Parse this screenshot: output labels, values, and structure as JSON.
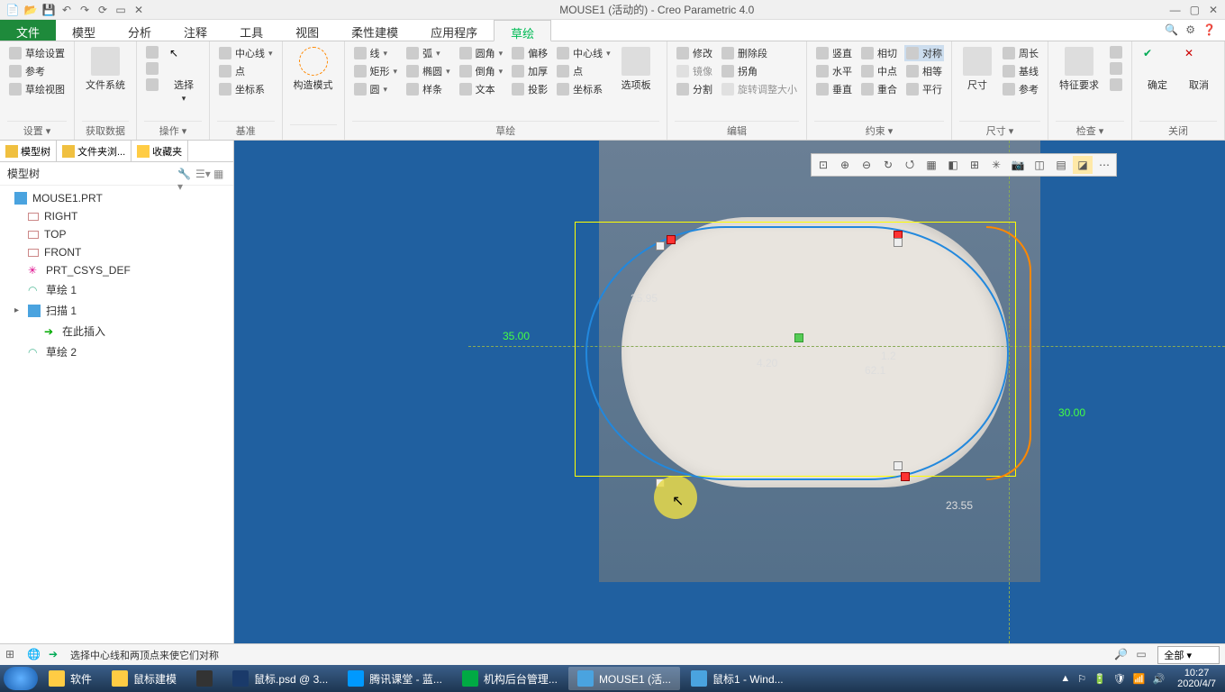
{
  "window": {
    "title": "MOUSE1 (活动的) - Creo Parametric 4.0"
  },
  "tabs": {
    "file": "文件",
    "model": "模型",
    "analyze": "分析",
    "annotate": "注释",
    "tool": "工具",
    "view": "视图",
    "flex": "柔性建模",
    "app": "应用程序",
    "sketch": "草绘"
  },
  "groups": {
    "setup": {
      "label": "设置 ▾",
      "items": [
        "草绘设置",
        "参考",
        "草绘视图"
      ]
    },
    "getdata": {
      "label": "获取数据",
      "btn": "文件系统"
    },
    "ops": {
      "label": "操作 ▾",
      "sel": "选择",
      "cut": "剪切",
      "copy": "复制",
      "paste": "粘贴"
    },
    "datum": {
      "label": "基准",
      "centerline": "中心线",
      "point": "点",
      "csys": "坐标系"
    },
    "construct": {
      "label": "",
      "btn": "构造模式"
    },
    "sketch": {
      "label": "草绘",
      "line": "线",
      "arc": "弧",
      "fillet": "圆角",
      "offset": "偏移",
      "c2": "中心线",
      "rect": "矩形",
      "ellipse": "椭圆",
      "chamfer": "倒角",
      "thick": "加厚",
      "pt": "点",
      "circle": "圆",
      "spline": "样条",
      "text": "文本",
      "project": "投影",
      "csys2": "坐标系",
      "palette": "选项板"
    },
    "edit": {
      "label": "编辑",
      "modify": "修改",
      "delseg": "删除段",
      "mirror": "镜像",
      "corner": "拐角",
      "divide": "分割",
      "rotres": "旋转调整大小"
    },
    "constrain": {
      "label": "约束 ▾",
      "vert": "竖直",
      "tangent": "相切",
      "sym": "对称",
      "horiz": "水平",
      "mid": "中点",
      "equal": "相等",
      "perp": "垂直",
      "coinc": "重合",
      "para": "平行"
    },
    "dimension": {
      "label": "尺寸 ▾",
      "dim": "尺寸",
      "perim": "周长",
      "base": "基线",
      "ref": "参考"
    },
    "inspect": {
      "label": "检查 ▾",
      "feat": "特征要求",
      "a": "▦",
      "b": "▨"
    },
    "close": {
      "label": "关闭",
      "ok": "确定",
      "cancel": "取消"
    }
  },
  "tree": {
    "tabs": [
      "模型树",
      "文件夹浏...",
      "收藏夹"
    ],
    "header": "模型树",
    "root": "MOUSE1.PRT",
    "items": [
      {
        "name": "RIGHT",
        "type": "datum"
      },
      {
        "name": "TOP",
        "type": "datum"
      },
      {
        "name": "FRONT",
        "type": "datum"
      },
      {
        "name": "PRT_CSYS_DEF",
        "type": "csys"
      },
      {
        "name": "草绘 1",
        "type": "sketch"
      },
      {
        "name": "扫描 1",
        "type": "feature",
        "exp": true
      },
      {
        "name": "在此插入",
        "type": "insert",
        "sub": true
      },
      {
        "name": "草绘 2",
        "type": "sketch"
      }
    ]
  },
  "dims": {
    "d1": "25.95",
    "d2": "35.00",
    "d3": "30.00",
    "d4": "4.20",
    "d5": "62.1",
    "d6": "23.55",
    "d7": "1.2"
  },
  "status": {
    "msg": "选择中心线和两顶点来使它们对称",
    "filter": "全部"
  },
  "taskbar": {
    "items": [
      "软件",
      "鼠标建模",
      "",
      "鼠标.psd @ 3...",
      "腾讯课堂 - 蓝...",
      "机构后台管理...",
      "MOUSE1 (活...",
      "鼠标1 - Wind..."
    ],
    "time": "10:27",
    "date": "2020/4/7"
  }
}
